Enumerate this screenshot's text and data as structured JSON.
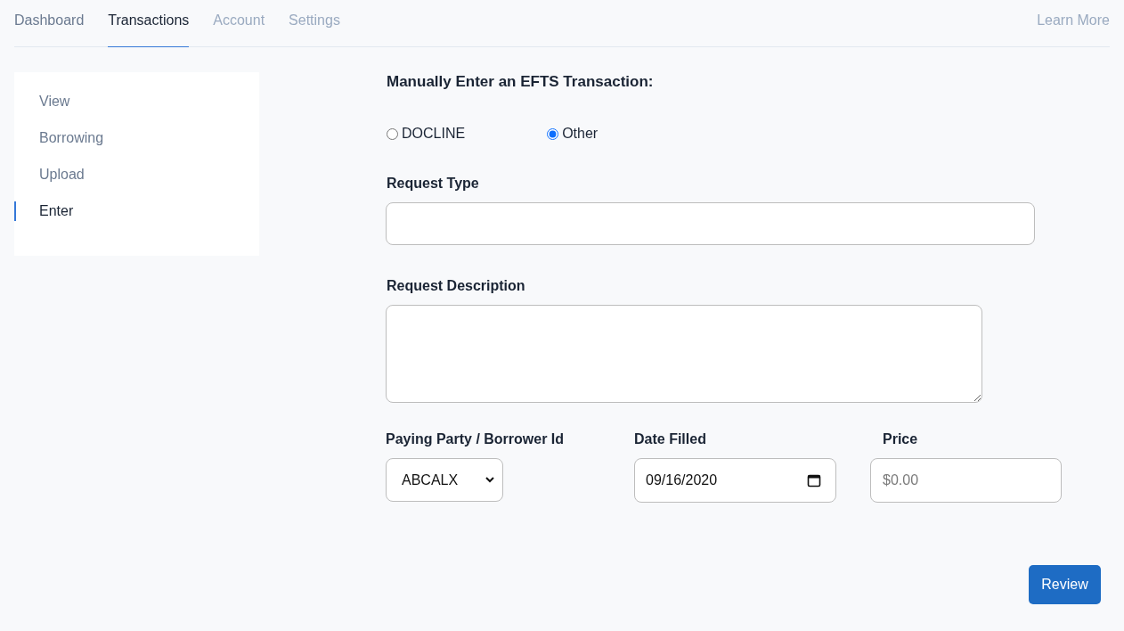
{
  "nav": {
    "tabs": [
      {
        "label": "Dashboard",
        "selected": false,
        "muted": false
      },
      {
        "label": "Transactions",
        "selected": true,
        "muted": false
      },
      {
        "label": "Account",
        "selected": false,
        "muted": true
      },
      {
        "label": "Settings",
        "selected": false,
        "muted": true
      }
    ],
    "link": "Learn More"
  },
  "sidebar": {
    "items": [
      {
        "label": "View",
        "selected": false
      },
      {
        "label": "Borrowing",
        "selected": false
      },
      {
        "label": "Upload",
        "selected": false
      },
      {
        "label": "Enter",
        "selected": true
      }
    ]
  },
  "form": {
    "title": "Manually Enter an EFTS Transaction:",
    "source_options": [
      {
        "label": "DOCLINE",
        "selected": false
      },
      {
        "label": "Other",
        "selected": true
      }
    ],
    "request_type": {
      "label": "Request Type"
    },
    "request_description": {
      "label": "Request Description"
    },
    "paying_party": {
      "label": "Paying Party / Borrower Id",
      "value": "ABCALX"
    },
    "date_filled": {
      "label": "Date Filled",
      "value": "09/16/2020"
    },
    "price": {
      "label": "Price",
      "placeholder": "$0.00"
    },
    "submit": "Review"
  }
}
